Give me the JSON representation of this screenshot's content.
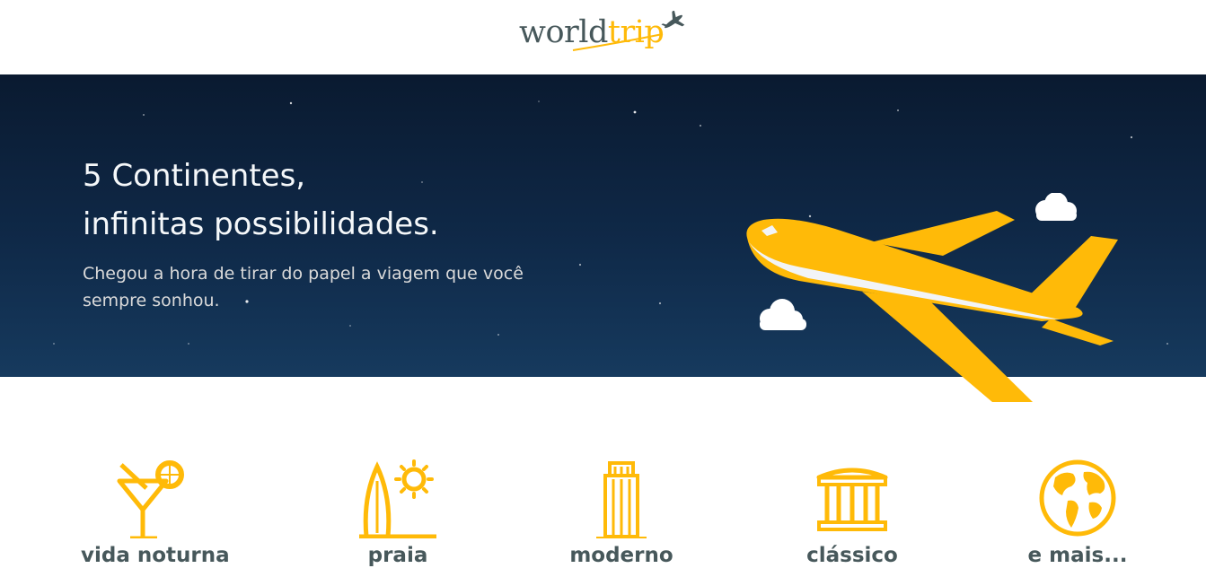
{
  "header": {
    "logo_world": "world",
    "logo_trip": "trip",
    "logo_icon": "airplane-icon"
  },
  "banner": {
    "title_line1": "5 Continentes,",
    "title_line2": "infinitas possibilidades.",
    "subtitle": "Chegou a hora de tirar do papel a viagem que você sempre sonhou.",
    "illustration": "airplane-illustration"
  },
  "travel_types": [
    {
      "label": "vida noturna",
      "icon": "cocktail-icon"
    },
    {
      "label": "praia",
      "icon": "surfboard-sun-icon"
    },
    {
      "label": "moderno",
      "icon": "skyscraper-icon"
    },
    {
      "label": "clássico",
      "icon": "classical-building-icon"
    },
    {
      "label": "e mais...",
      "icon": "globe-icon"
    }
  ],
  "colors": {
    "accent": "#FFBA08",
    "text_dark": "#47585B",
    "banner_bg": "#0f2948",
    "light_text": "#F5F8FA"
  }
}
